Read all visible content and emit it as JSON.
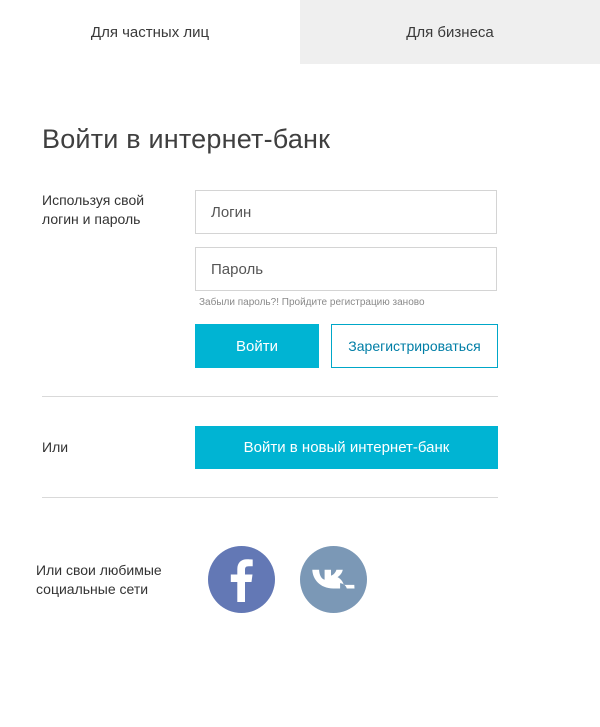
{
  "tabs": [
    {
      "label": "Для частных лиц",
      "active": true
    },
    {
      "label": "Для бизнеса",
      "active": false
    }
  ],
  "title": "Войти в интернет-банк",
  "login": {
    "label": "Используя свой логин и пароль",
    "login_placeholder": "Логин",
    "password_placeholder": "Пароль",
    "hint": "Забыли пароль?! Пройдите регистрацию заново",
    "submit_label": "Войти",
    "register_label": "Зарегистрироваться"
  },
  "alt": {
    "label": "Или",
    "button_label": "Войти в новый интернет-банк"
  },
  "social": {
    "label": "Или свои любимые социальные сети",
    "networks": [
      {
        "name": "facebook-icon",
        "color": "#6378b5"
      },
      {
        "name": "vk-icon",
        "color": "#7b98b6"
      }
    ]
  },
  "colors": {
    "accent": "#00b4d3",
    "tab_inactive_bg": "#efefef"
  }
}
